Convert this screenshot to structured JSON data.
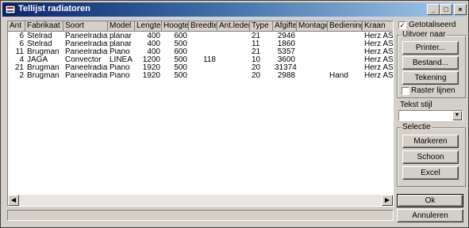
{
  "window": {
    "title": "Tellijst radiatoren"
  },
  "table": {
    "columns": [
      "Ant",
      "Fabrikaat",
      "Soort",
      "Model",
      "Lengte",
      "Hoogte",
      "Breedte",
      "Ant.leden",
      "Type",
      "Afgifte",
      "Montage",
      "Bediening",
      "Kraan"
    ],
    "rows": [
      [
        "6",
        "Stelrad",
        "Paneelradiator",
        "planar",
        "400",
        "600",
        "",
        "",
        "21",
        "2946",
        "",
        "",
        "Herz AS-T h"
      ],
      [
        "6",
        "Stelrad",
        "Paneelradiator",
        "planar",
        "400",
        "500",
        "",
        "",
        "11",
        "1860",
        "",
        "",
        "Herz AS-T h"
      ],
      [
        "11",
        "Brugman",
        "Paneelradiator",
        "Piano",
        "400",
        "600",
        "",
        "",
        "21",
        "5357",
        "",
        "",
        "Herz AS-T h"
      ],
      [
        "4",
        "JAGA",
        "Convector",
        "LINEA",
        "1200",
        "500",
        "118",
        "",
        "10",
        "3600",
        "",
        "",
        "Herz AS-T h"
      ],
      [
        "21",
        "Brugman",
        "Paneelradiator",
        "Piano",
        "1920",
        "500",
        "",
        "",
        "20",
        "31374",
        "",
        "",
        "Herz AS-T h"
      ],
      [
        "2",
        "Brugman",
        "Paneelradiator",
        "Piano",
        "1920",
        "500",
        "",
        "",
        "20",
        "2988",
        "",
        "Hand",
        "Herz AS-T h"
      ]
    ]
  },
  "right_panel": {
    "getotaliseerd_label": "Getotaliseerd",
    "getotaliseerd_checked": true,
    "uitvoer_label": "Uitvoer naar",
    "printer_label": "Printer...",
    "bestand_label": "Bestand...",
    "tekening_label": "Tekening",
    "raster_label": "Raster lijnen",
    "raster_checked": false,
    "tekststijl_label": "Tekst stijl",
    "tekststijl_value": "",
    "selectie_label": "Selectie",
    "markeren_label": "Markeren",
    "schoon_label": "Schoon",
    "excel_label": "Excel",
    "ok_label": "Ok",
    "annuleren_label": "Annuleren"
  }
}
